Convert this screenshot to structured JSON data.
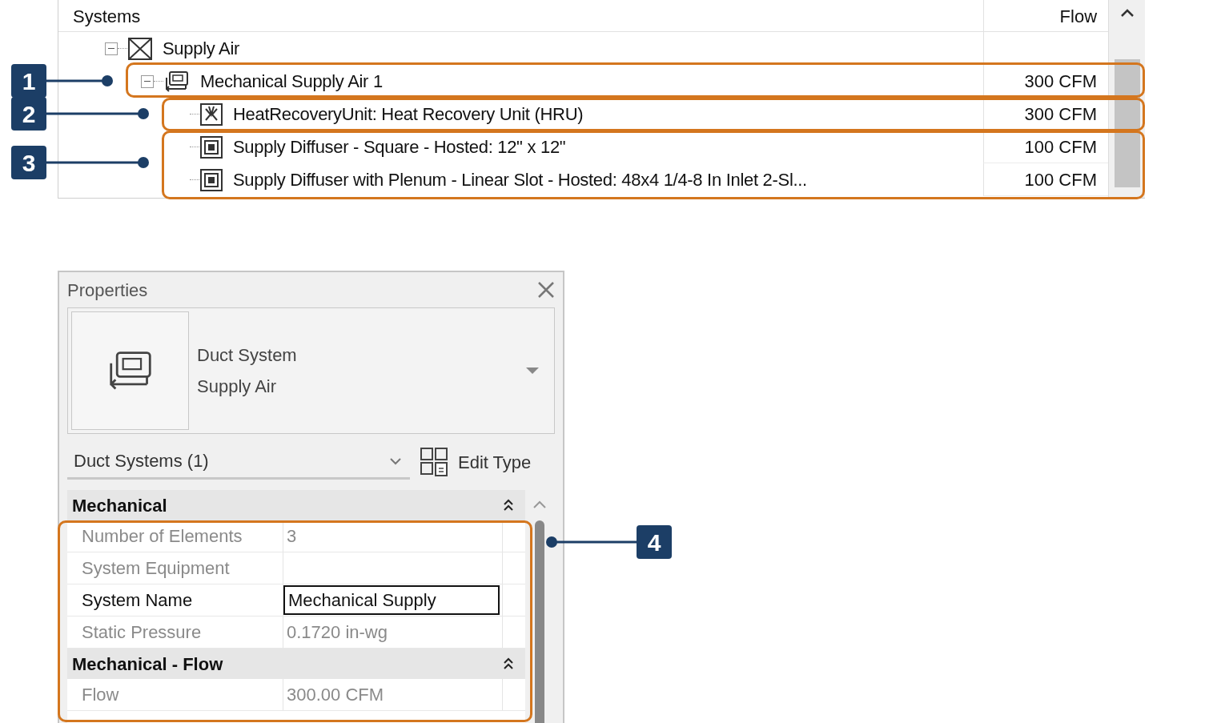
{
  "system_browser": {
    "columns": [
      "Systems",
      "Flow"
    ],
    "rows": [
      {
        "kind": "system-type",
        "name": "Supply Air",
        "flow": "",
        "expanded": true,
        "children": [
          {
            "kind": "duct-system",
            "name": "Mechanical Supply Air 1",
            "flow": "300 CFM",
            "expanded": true,
            "children": [
              {
                "kind": "equipment",
                "name": "HeatRecoveryUnit: Heat Recovery Unit (HRU)",
                "flow": "300 CFM"
              },
              {
                "kind": "diffuser",
                "name": "Supply Diffuser - Square - Hosted: 12\" x 12\"",
                "flow": "100 CFM"
              },
              {
                "kind": "diffuser",
                "name": "Supply Diffuser with Plenum - Linear Slot - Hosted: 48x4 1/4-8 In Inlet 2-Sl...",
                "flow": "100 CFM"
              }
            ]
          }
        ]
      }
    ]
  },
  "callouts": [
    {
      "number": "1"
    },
    {
      "number": "2"
    },
    {
      "number": "3"
    },
    {
      "number": "4"
    }
  ],
  "properties": {
    "title": "Properties",
    "type_name": "Duct System",
    "type_value": "Supply Air",
    "filter": "Duct Systems (1)",
    "edit_type": "Edit Type",
    "groups": [
      {
        "name": "Mechanical",
        "rows": [
          {
            "label": "Number of Elements",
            "value": "3",
            "editable": false
          },
          {
            "label": "System Equipment",
            "value": "",
            "editable": false
          },
          {
            "label": "System Name",
            "value": "Mechanical Supply",
            "editable": true
          },
          {
            "label": "Static Pressure",
            "value": "0.1720 in-wg",
            "editable": false
          }
        ]
      },
      {
        "name": "Mechanical - Flow",
        "rows": [
          {
            "label": "Flow",
            "value": "300.00 CFM",
            "editable": false
          }
        ]
      }
    ]
  }
}
